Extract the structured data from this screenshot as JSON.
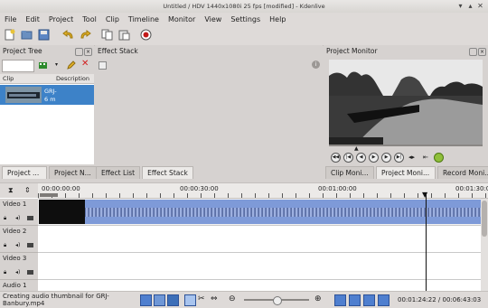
{
  "window": {
    "title": "Untitled / HDV 1440x1080i 25 fps [modified] - Kdenlive"
  },
  "menu": [
    "File",
    "Edit",
    "Project",
    "Tool",
    "Clip",
    "Timeline",
    "Monitor",
    "View",
    "Settings",
    "Help"
  ],
  "project_tree": {
    "title": "Project Tree",
    "columns": {
      "clip": "Clip",
      "description": "Description"
    },
    "clip": {
      "name": "GRJ-",
      "duration": "6 m"
    }
  },
  "effect_stack": {
    "title": "Effect Stack"
  },
  "project_monitor": {
    "title": "Project Monitor"
  },
  "left_tabs": [
    "Project ...",
    "Project N..."
  ],
  "mid_tabs": [
    "Effect List",
    "Effect Stack"
  ],
  "right_tabs": [
    "Clip Moni...",
    "Project Moni...",
    "Record Moni..."
  ],
  "timeline": {
    "ruler": [
      "00:00:00:00",
      "00:00:30:00",
      "00:01:00:00",
      "00:01:30:00"
    ],
    "tracks": [
      "Video 1",
      "Video 2",
      "Video 3",
      "Audio 1"
    ]
  },
  "status": {
    "message": "Creating audio thumbnail for GRJ-\nBanbury.mp4",
    "timecode": "00:01:24:22 / 00:06:43:03"
  }
}
